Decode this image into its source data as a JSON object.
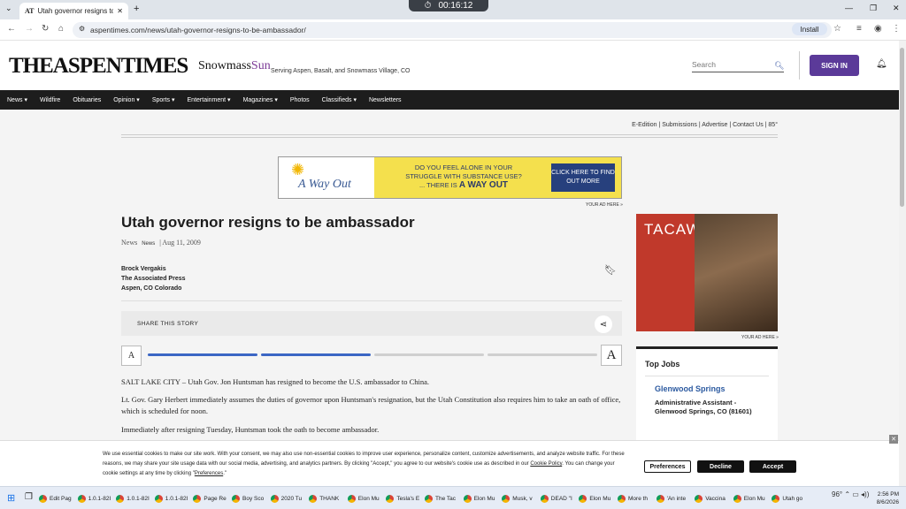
{
  "browser": {
    "tab_favicon": "AT",
    "tab_title": "Utah governor resigns to be am",
    "new_tab": "+",
    "timer": "00:16:12",
    "url": "aspentimes.com/news/utah-governor-resigns-to-be-ambassador/",
    "install": "Install"
  },
  "header": {
    "logo": "THEASPENTIMES",
    "sub_logo_a": "Snowmass",
    "sub_logo_b": "Sun",
    "tagline": "Serving Aspen, Basalt, and Snowmass Village, CO",
    "search_placeholder": "Search",
    "sign_in": "SIGN IN"
  },
  "nav": [
    "News ▾",
    "Wildfire",
    "Obituaries",
    "Opinion ▾",
    "Sports ▾",
    "Entertainment ▾",
    "Magazines ▾",
    "Photos",
    "Classifieds ▾",
    "Newsletters"
  ],
  "utility": "E-Edition  |  Submissions  |  Advertise  |  Contact Us  |  85°",
  "ad1": {
    "brand": "A Way Out",
    "line1": "DO YOU FEEL ALONE IN YOUR",
    "line2": "STRUGGLE WITH SUBSTANCE USE?",
    "line3a": "... THERE IS ",
    "line3b": "A WAY OUT",
    "cta": "CLICK HERE TO FIND OUT MORE",
    "adhere": "YOUR AD HERE »"
  },
  "article": {
    "headline": "Utah governor resigns to be ambassador",
    "section": "News",
    "tag": "News",
    "date": "| Aug 11, 2009",
    "byline": [
      "Brock Vergakis",
      "The Associated Press",
      "Aspen, CO Colorado"
    ],
    "share": "SHARE THIS STORY",
    "font_small": "A",
    "font_large": "A",
    "p1": "SALT LAKE CITY – Utah Gov. Jon Huntsman has resigned to become the U.S. ambassador to China.",
    "p2": "Lt. Gov. Gary Herbert immediately assumes the duties of governor upon Huntsman's resignation, but the Utah Constitution also requires him to take an oath of office, which is scheduled for noon.",
    "p3": "Immediately after resigning Tuesday, Huntsman took the oath to become ambassador."
  },
  "ad2": {
    "brand": "TACAW",
    "adhere": "YOUR AD HERE »"
  },
  "jobs": {
    "heading": "Top Jobs",
    "location": "Glenwood Springs",
    "title": "Administrative Assistant - Glenwood Springs, CO (81601)"
  },
  "cookie": {
    "text_a": "We use essential cookies to make our site work. With your consent, we may also use non-essential cookies to improve user experience, personalize content, customize advertisements, and analyze website traffic. For these reasons, we may share your site usage data with our social media, advertising, and analytics partners. By clicking \"Accept,\" you agree to our website's cookie use as described in our ",
    "policy": "Cookie Policy",
    "text_b": ". You can change your cookie settings at any time by clicking \"",
    "prefs_link": "Preferences",
    "text_c": ".\"",
    "preferences": "Preferences",
    "decline": "Decline",
    "accept": "Accept"
  },
  "taskbar": {
    "items": [
      "Edit Pag",
      "1.0.1-82I",
      "1.0.1-82I",
      "1.0.1-82I",
      "Page Re",
      "Boy Sco",
      "2020 Tu",
      "THANK",
      "Elon Mu",
      "Tesla's E",
      "The Tac",
      "Elon Mu",
      "Musk, v",
      "DEAD \"I",
      "Elon Mu",
      "More th",
      "'An inte",
      "Vaccina",
      "Elon Mu",
      "Utah go"
    ],
    "weather": "96°",
    "time": "2:56 PM",
    "date": "8/6/2026"
  }
}
